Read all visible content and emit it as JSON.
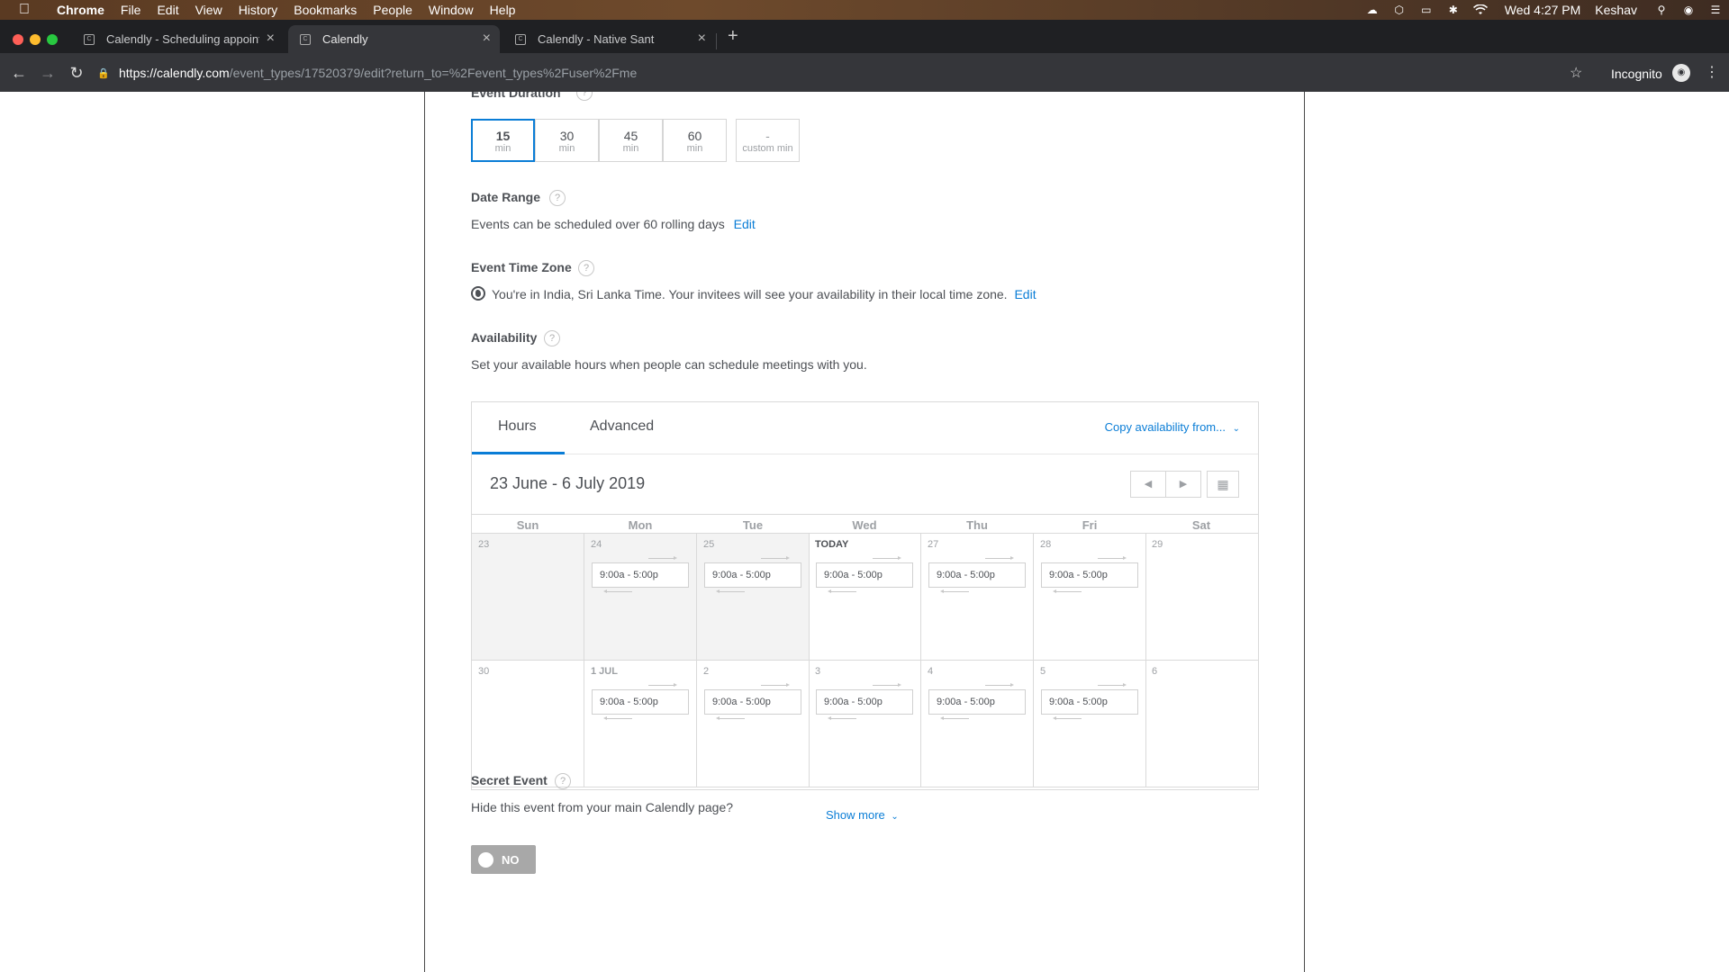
{
  "menubar": {
    "app": "Chrome",
    "items": [
      "File",
      "Edit",
      "View",
      "History",
      "Bookmarks",
      "People",
      "Window",
      "Help"
    ],
    "clock": "Wed 4:27 PM",
    "user": "Keshav"
  },
  "tabs": [
    {
      "title": "Calendly - Scheduling appointments",
      "active": false
    },
    {
      "title": "Calendly",
      "active": true
    },
    {
      "title": "Calendly - Native Sant",
      "active": false
    }
  ],
  "toolbar": {
    "url_host": "https://calendly.com",
    "url_path": "/event_types/17520379/edit?return_to=%2Fevent_types%2Fuser%2Fme",
    "incognito_label": "Incognito"
  },
  "event_duration": {
    "title": "Event Duration",
    "options": [
      {
        "value": "15",
        "unit": "min",
        "selected": true
      },
      {
        "value": "30",
        "unit": "min",
        "selected": false
      },
      {
        "value": "45",
        "unit": "min",
        "selected": false
      },
      {
        "value": "60",
        "unit": "min",
        "selected": false
      }
    ],
    "custom": {
      "value": "-",
      "unit": "custom min"
    }
  },
  "date_range": {
    "title": "Date Range",
    "text": "Events can be scheduled over 60 rolling days",
    "edit_label": "Edit"
  },
  "time_zone": {
    "title": "Event Time Zone",
    "text": "You're in India, Sri Lanka Time. Your invitees will see your availability in their local time zone.",
    "edit_label": "Edit"
  },
  "availability": {
    "title": "Availability",
    "text": "Set your available hours when people can schedule meetings with you.",
    "tabs": [
      "Hours",
      "Advanced"
    ],
    "copy_label": "Copy availability from...",
    "date_range_label": "23 June - 6 July 2019",
    "weekdays": [
      "Sun",
      "Mon",
      "Tue",
      "Wed",
      "Thu",
      "Fri",
      "Sat"
    ],
    "weeks": [
      [
        {
          "label": "23",
          "slot": "",
          "past": true
        },
        {
          "label": "24",
          "slot": "9:00a - 5:00p",
          "past": true
        },
        {
          "label": "25",
          "slot": "9:00a - 5:00p",
          "past": true
        },
        {
          "label": "TODAY",
          "slot": "9:00a - 5:00p",
          "past": false
        },
        {
          "label": "27",
          "slot": "9:00a - 5:00p",
          "past": false
        },
        {
          "label": "28",
          "slot": "9:00a - 5:00p",
          "past": false
        },
        {
          "label": "29",
          "slot": "",
          "past": false
        }
      ],
      [
        {
          "label": "30",
          "slot": "",
          "past": false
        },
        {
          "label": "1 JUL",
          "slot": "9:00a - 5:00p",
          "past": false
        },
        {
          "label": "2",
          "slot": "9:00a - 5:00p",
          "past": false
        },
        {
          "label": "3",
          "slot": "9:00a - 5:00p",
          "past": false
        },
        {
          "label": "4",
          "slot": "9:00a - 5:00p",
          "past": false
        },
        {
          "label": "5",
          "slot": "9:00a - 5:00p",
          "past": false
        },
        {
          "label": "6",
          "slot": "",
          "past": false
        }
      ]
    ],
    "show_more_label": "Show more"
  },
  "secret_event": {
    "title": "Secret Event",
    "text": "Hide this event from your main Calendly page?",
    "toggle_label": "NO"
  },
  "colors": {
    "accent": "#0a7dd6",
    "past_day": "#f3f3f3",
    "toggle_off": "#a8a8a8"
  }
}
